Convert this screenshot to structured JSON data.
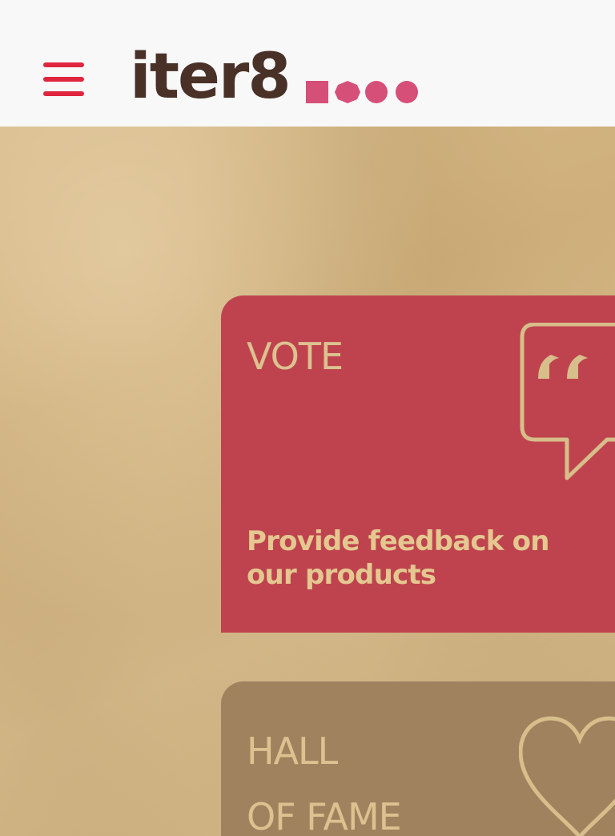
{
  "header": {
    "menu_icon": "hamburger-menu-icon",
    "logo_text": "iter8",
    "logo_dots_icon": "dots-icon",
    "brand_color": "#e0263e",
    "logo_color": "#4a3128",
    "dot_color": "#d64f78"
  },
  "cards": [
    {
      "title": "VOTE",
      "description": "Provide feedback on our products",
      "icon": "speech-bubble-quote-icon",
      "background": "#bf434e"
    },
    {
      "title_line1": "HALL",
      "title_line2": "OF FAME",
      "icon": "heart-icon",
      "background": "#a1825f"
    }
  ]
}
